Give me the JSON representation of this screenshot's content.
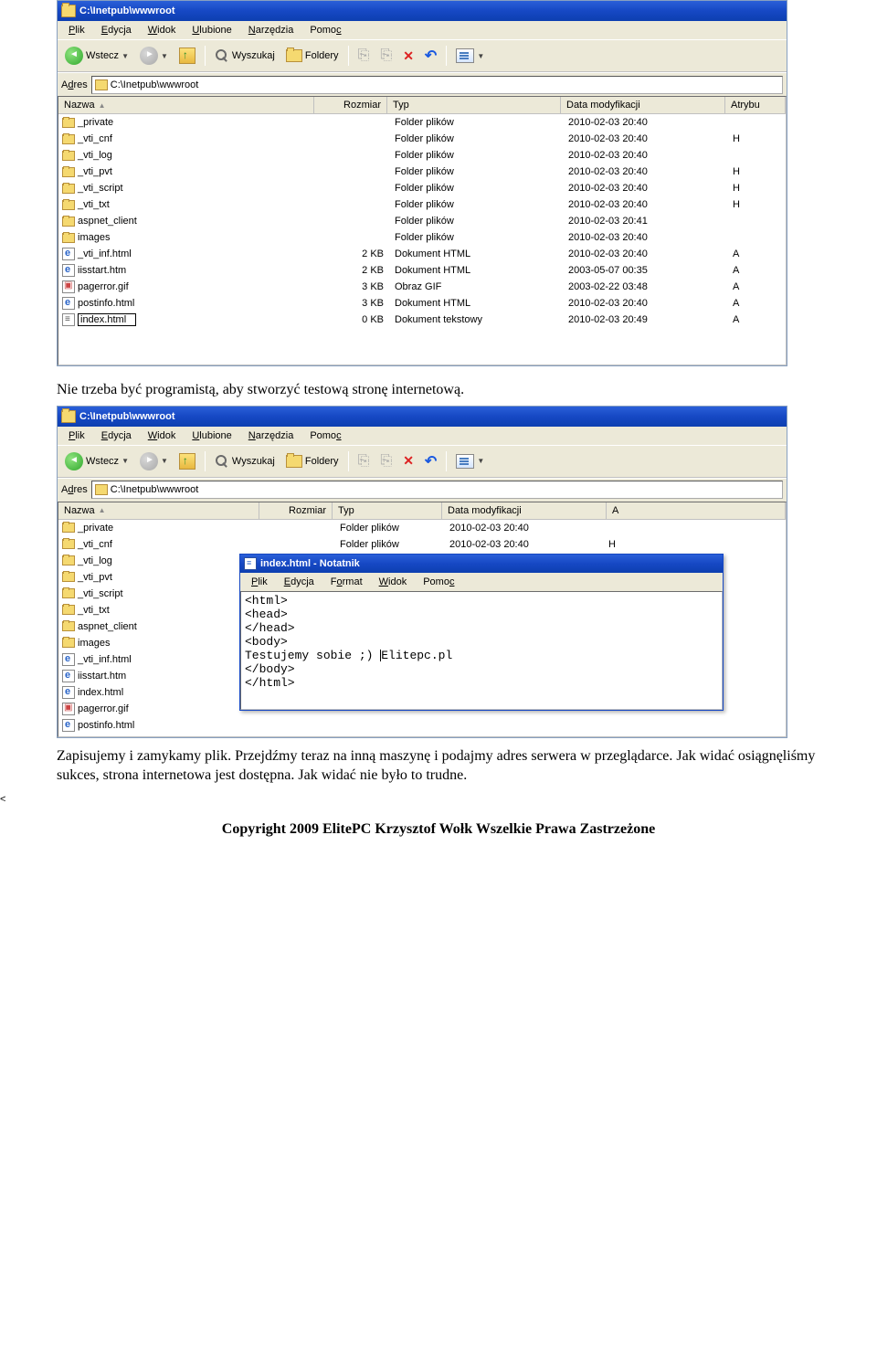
{
  "explorer1": {
    "title": "C:\\Inetpub\\wwwroot",
    "menu": [
      "Plik",
      "Edycja",
      "Widok",
      "Ulubione",
      "Narzędzia",
      "Pomoc"
    ],
    "toolbar": {
      "back": "Wstecz",
      "search": "Wyszukaj",
      "folders": "Foldery"
    },
    "address_label": "Adres",
    "address": "C:\\Inetpub\\wwwroot",
    "columns": {
      "name": "Nazwa",
      "size": "Rozmiar",
      "type": "Typ",
      "date": "Data modyfikacji",
      "attr": "Atrybu"
    },
    "rows": [
      {
        "icon": "folder",
        "name": "_private",
        "size": "",
        "type": "Folder plików",
        "date": "2010-02-03 20:40",
        "attr": ""
      },
      {
        "icon": "folder",
        "name": "_vti_cnf",
        "size": "",
        "type": "Folder plików",
        "date": "2010-02-03 20:40",
        "attr": "H"
      },
      {
        "icon": "folder",
        "name": "_vti_log",
        "size": "",
        "type": "Folder plików",
        "date": "2010-02-03 20:40",
        "attr": ""
      },
      {
        "icon": "folder",
        "name": "_vti_pvt",
        "size": "",
        "type": "Folder plików",
        "date": "2010-02-03 20:40",
        "attr": "H"
      },
      {
        "icon": "folder",
        "name": "_vti_script",
        "size": "",
        "type": "Folder plików",
        "date": "2010-02-03 20:40",
        "attr": "H"
      },
      {
        "icon": "folder",
        "name": "_vti_txt",
        "size": "",
        "type": "Folder plików",
        "date": "2010-02-03 20:40",
        "attr": "H"
      },
      {
        "icon": "folder",
        "name": "aspnet_client",
        "size": "",
        "type": "Folder plików",
        "date": "2010-02-03 20:41",
        "attr": ""
      },
      {
        "icon": "folder",
        "name": "images",
        "size": "",
        "type": "Folder plików",
        "date": "2010-02-03 20:40",
        "attr": ""
      },
      {
        "icon": "html",
        "name": "_vti_inf.html",
        "size": "2 KB",
        "type": "Dokument HTML",
        "date": "2010-02-03 20:40",
        "attr": "A"
      },
      {
        "icon": "html",
        "name": "iisstart.htm",
        "size": "2 KB",
        "type": "Dokument HTML",
        "date": "2003-05-07 00:35",
        "attr": "A"
      },
      {
        "icon": "gif",
        "name": "pagerror.gif",
        "size": "3 KB",
        "type": "Obraz GIF",
        "date": "2003-02-22 03:48",
        "attr": "A"
      },
      {
        "icon": "html",
        "name": "postinfo.html",
        "size": "3 KB",
        "type": "Dokument HTML",
        "date": "2010-02-03 20:40",
        "attr": "A"
      },
      {
        "icon": "txt",
        "name": "index.html",
        "size": "0 KB",
        "type": "Dokument tekstowy",
        "date": "2010-02-03 20:49",
        "attr": "A",
        "edit": true
      }
    ]
  },
  "text1": "Nie trzeba być programistą, aby stworzyć testową stronę internetową.",
  "explorer2": {
    "title": "C:\\Inetpub\\wwwroot",
    "menu": [
      "Plik",
      "Edycja",
      "Widok",
      "Ulubione",
      "Narzędzia",
      "Pomoc"
    ],
    "toolbar": {
      "back": "Wstecz",
      "search": "Wyszukaj",
      "folders": "Foldery"
    },
    "address_label": "Adres",
    "address": "C:\\Inetpub\\wwwroot",
    "columns": {
      "name": "Nazwa",
      "size": "Rozmiar",
      "type": "Typ",
      "date": "Data modyfikacji",
      "attr": "A"
    },
    "rows": [
      {
        "icon": "folder",
        "name": "_private",
        "type": "Folder plików",
        "date": "2010-02-03 20:40"
      },
      {
        "icon": "folder",
        "name": "_vti_cnf",
        "type": "Folder plików",
        "date": "2010-02-03 20:40",
        "attr": "H"
      },
      {
        "icon": "folder",
        "name": "_vti_log"
      },
      {
        "icon": "folder",
        "name": "_vti_pvt"
      },
      {
        "icon": "folder",
        "name": "_vti_script"
      },
      {
        "icon": "folder",
        "name": "_vti_txt"
      },
      {
        "icon": "folder",
        "name": "aspnet_client"
      },
      {
        "icon": "folder",
        "name": "images"
      },
      {
        "icon": "html",
        "name": "_vti_inf.html"
      },
      {
        "icon": "html",
        "name": "iisstart.htm"
      },
      {
        "icon": "html",
        "name": "index.html"
      },
      {
        "icon": "gif",
        "name": "pagerror.gif"
      },
      {
        "icon": "html",
        "name": "postinfo.html"
      }
    ]
  },
  "notepad": {
    "title": "index.html - Notatnik",
    "menu": [
      "Plik",
      "Edycja",
      "Format",
      "Widok",
      "Pomoc"
    ],
    "content": "<html>\n<head>\n</head>\n<body>\nTestujemy sobie ;) Elitepc.pl\n</body>\n</html>"
  },
  "text2": "Zapisujemy i zamykamy plik. Przejdźmy teraz na inną maszynę i podajmy adres serwera w przeglądarce. Jak widać osiągnęliśmy sukces, strona internetowa jest dostępna. Jak widać nie było to trudne.",
  "copyright": "Copyright 2009 ElitePC Krzysztof Wołk Wszelkie Prawa Zastrzeżone"
}
